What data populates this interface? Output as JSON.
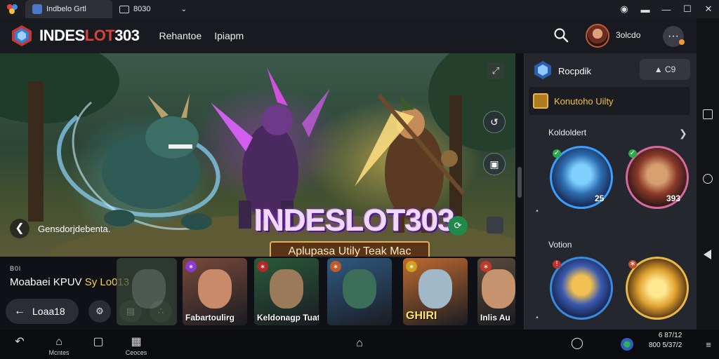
{
  "system_bar": {
    "tabs": [
      {
        "label": "Indbelo Grtl",
        "active": true
      },
      {
        "label": "8030",
        "active": false
      }
    ],
    "controls": [
      "record-icon",
      "minimize-icon",
      "restore-icon",
      "close-icon"
    ]
  },
  "header": {
    "brand_prefix": "INDES",
    "brand_accent": "LOT",
    "brand_suffix": "303",
    "nav": [
      "Rehantoe",
      "Ipiapm"
    ],
    "username": "3olcdo"
  },
  "hero": {
    "title": "INDESLOT303",
    "subtitle": "Aplupasa Utily Teak Mac",
    "caption": "Gensdorjdebenta."
  },
  "lower": {
    "tag": "B0l",
    "title_main": "Moabaei KPUV",
    "title_accent": "Sy Lo013",
    "pill_label": "Loaa18",
    "cards": [
      {
        "label": "Fabartoulirg",
        "badge_color": "#8a3ad0",
        "bg": "#7a4a3a",
        "face": "#c98a6a"
      },
      {
        "label": "Keldonagp Tuat",
        "badge_color": "#b02a2a",
        "bg": "#2a5a3a",
        "face": "#9a7a5a"
      },
      {
        "label": "",
        "badge_color": "#c05a2a",
        "bg": "#2f5a82",
        "face": "#3c6f5a"
      },
      {
        "label": "GHIRI",
        "badge_color": "#d0a020",
        "bg": "#c06a30",
        "face": "#a0b8c8"
      },
      {
        "label": "Inlis Au",
        "badge_color": "#c03a2a",
        "bg": "#5a4a3a",
        "face": "#c7936e"
      }
    ]
  },
  "panel": {
    "title": "Rocpdik",
    "button_label": "C9",
    "utility_label": "Konutoho Uilty",
    "section1": "Koldoldert",
    "section2": "Votion",
    "hero_values": [
      "25",
      "393"
    ]
  },
  "bottom_nav": {
    "items": [
      "Mcntes",
      "",
      "Ceoces"
    ],
    "time_line1": "6 87/12",
    "time_line2": "800 5/37/2"
  }
}
